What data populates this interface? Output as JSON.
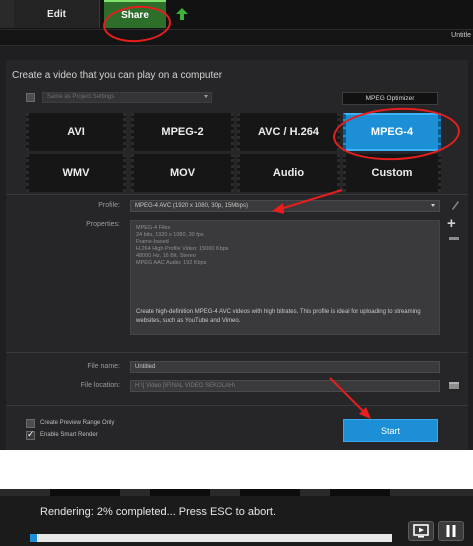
{
  "tabs": {
    "edit": "Edit",
    "share": "Share"
  },
  "document_title": "Untitle",
  "heading": "Create a video that you can play on a computer",
  "same_as_project": "Same as Project Settings",
  "optimizer": "MPEG Optimizer",
  "formats": [
    {
      "label": "AVI",
      "selected": false
    },
    {
      "label": "MPEG-2",
      "selected": false
    },
    {
      "label": "AVC / H.264",
      "selected": false
    },
    {
      "label": "MPEG-4",
      "selected": true
    },
    {
      "label": "WMV",
      "selected": false
    },
    {
      "label": "MOV",
      "selected": false
    },
    {
      "label": "Audio",
      "selected": false
    },
    {
      "label": "Custom",
      "selected": false
    }
  ],
  "profile": {
    "label": "Profile:",
    "value": "MPEG-4 AVC (1920 x 1080, 30p, 15Mbps)"
  },
  "properties": {
    "label": "Properties:",
    "lines": [
      "MPEG-4 Files",
      "24 bits, 1920 x 1080, 30 fps",
      "Frame-based",
      "H.264 High Profile Video: 15000 Kbps",
      "48000 Hz, 16 Bit, Stereo",
      "MPEG AAC Audio: 192 Kbps"
    ],
    "description": "Create high-definition MPEG-4 AVC videos with high bitrates. This profile is ideal for uploading to streaming websites, such as YouTube and Vimeo."
  },
  "file_name": {
    "label": "File name:",
    "value": "Untitled"
  },
  "file_location": {
    "label": "File location:",
    "value": "H:\\[ Video ]\\FINAL VIDEO SEKOLAH\\"
  },
  "checkboxes": [
    {
      "label": "Create Preview Range Only",
      "checked": false
    },
    {
      "label": "Enable Smart Render",
      "checked": true
    }
  ],
  "start_label": "Start",
  "rendering": {
    "text": "Rendering:  2% completed... Press ESC to abort.",
    "progress": 0.02
  },
  "colors": {
    "accent": "#1d8fd6",
    "share_tab": "#2d6e2b",
    "annotation": "#e61e1e"
  }
}
